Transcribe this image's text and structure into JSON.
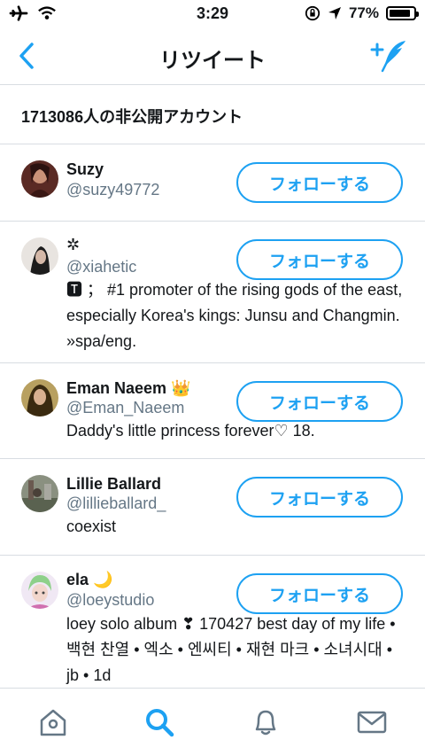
{
  "status_bar": {
    "time": "3:29",
    "battery": "77%"
  },
  "nav": {
    "title": "リツイート"
  },
  "private_count": "1713086人の非公開アカウント",
  "follow_label": "フォローする",
  "users": [
    {
      "name": "Suzy",
      "handle": "@suzy49772",
      "bio": ""
    },
    {
      "name": "✲",
      "handle": "@xiahetic",
      "bio": "🆃 ； #1 promoter of the rising gods of the east, especially Korea's kings: Junsu and Changmin. »spa/eng."
    },
    {
      "name": "Eman Naeem 👑",
      "handle": "@Eman_Naeem",
      "bio": "Daddy's little princess forever♡ 18."
    },
    {
      "name": "Lillie Ballard",
      "handle": "@lillieballard_",
      "bio": "coexist"
    },
    {
      "name": "ela 🌙",
      "handle": "@loeystudio",
      "bio": "loey solo album ❣ 170427 best day of my life • 백현 찬열 • 엑소 • 엔씨티 • 재현 마크 • 소녀시대 • jb • 1d"
    }
  ],
  "colors": {
    "accent": "#1da1f2",
    "secondary_text": "#657786",
    "divider": "#d8dde2"
  },
  "icons": {
    "status": [
      "airplane-icon",
      "wifi-icon",
      "rotation-lock-icon",
      "location-arrow-icon",
      "battery-icon"
    ],
    "nav": [
      "back-chevron-icon",
      "compose-tweet-icon"
    ],
    "tabs": [
      "home-icon",
      "search-icon",
      "notifications-icon",
      "messages-icon"
    ]
  }
}
